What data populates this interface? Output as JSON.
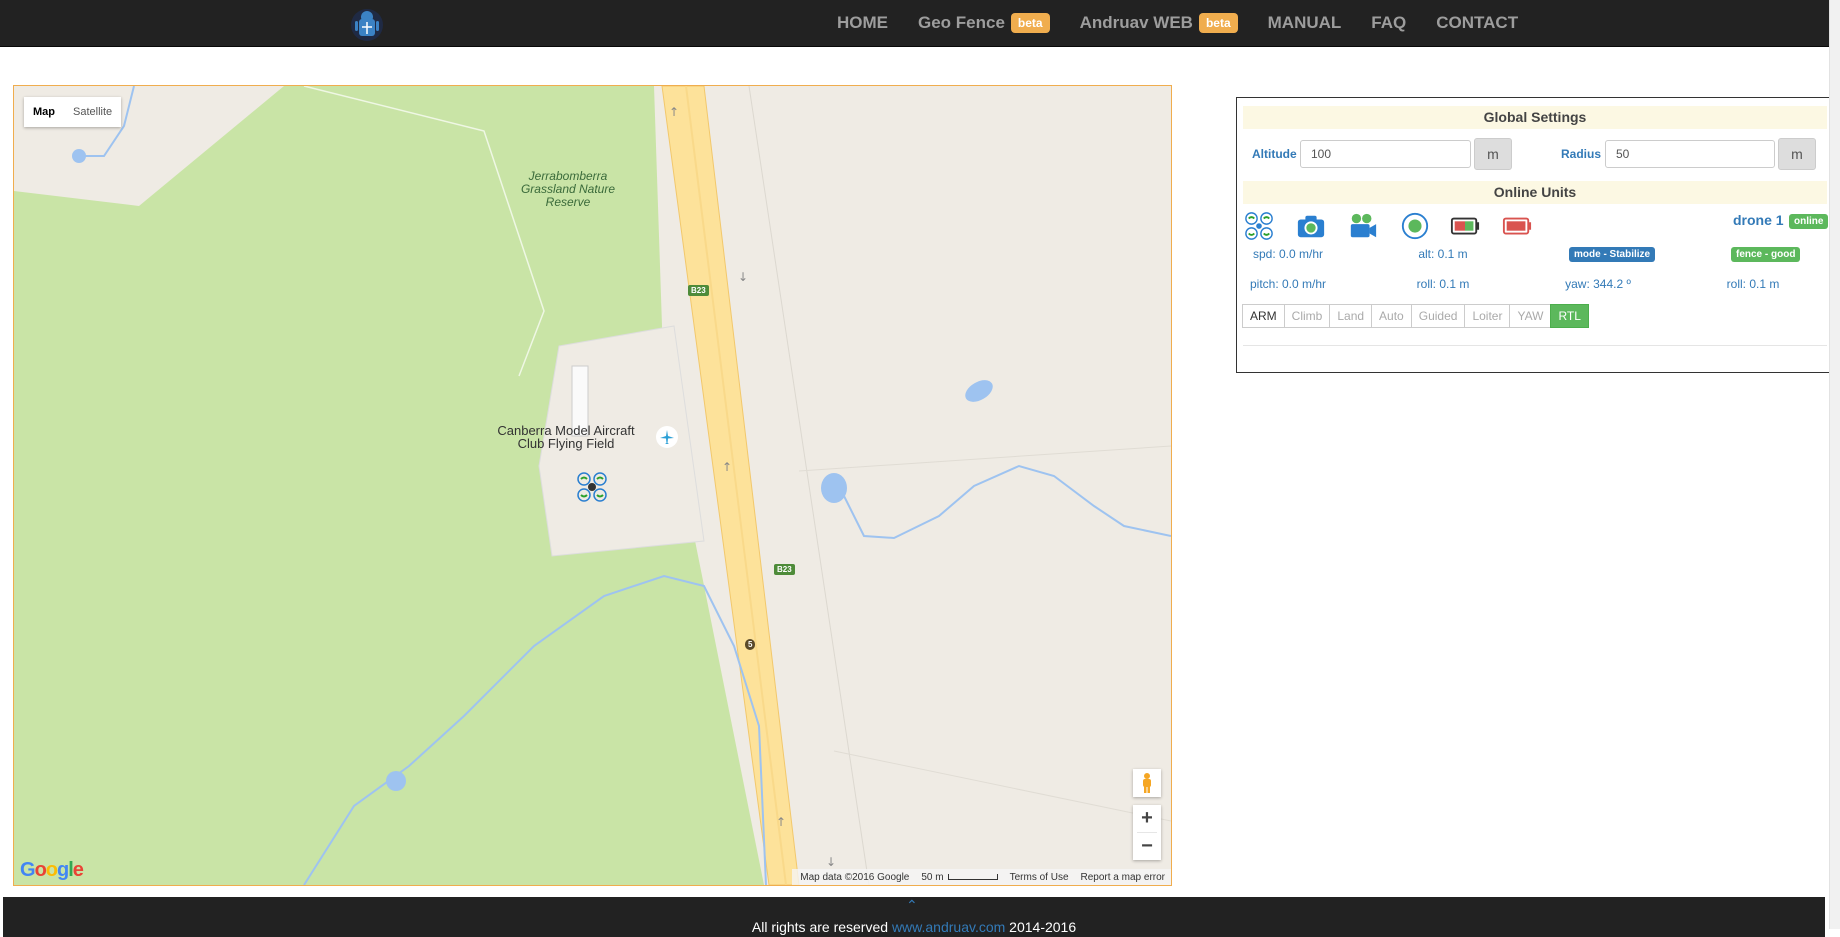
{
  "nav": {
    "items": [
      {
        "label": "HOME"
      },
      {
        "label": "Geo Fence",
        "badge": "beta"
      },
      {
        "label": "Andruav WEB",
        "badge": "beta"
      },
      {
        "label": "MANUAL"
      },
      {
        "label": "FAQ"
      },
      {
        "label": "CONTACT"
      }
    ]
  },
  "map": {
    "type_controls": {
      "map": "Map",
      "satellite": "Satellite"
    },
    "labels": {
      "reserve": "Jerrabomberra Grassland Nature Reserve",
      "field_line1": "Canberra Model Aircraft",
      "field_line2": "Club Flying Field",
      "road_shield": "B23",
      "route_marker": "5"
    },
    "zoom": {
      "in": "+",
      "out": "−"
    },
    "attribution": {
      "data": "Map data ©2016 Google",
      "scale": "50 m",
      "terms": "Terms of Use",
      "report": "Report a map error"
    },
    "logo": "Google"
  },
  "panel": {
    "global_settings": "Global Settings",
    "altitude_label": "Altitude",
    "altitude_value": "100",
    "altitude_unit": "m",
    "radius_label": "Radius",
    "radius_value": "50",
    "radius_unit": "m",
    "online_units": "Online Units",
    "unit": {
      "name": "drone 1",
      "status": "online",
      "icons": [
        "drone-icon",
        "camera-icon",
        "video-camera-icon",
        "record-icon",
        "battery-good-icon",
        "battery-low-icon"
      ],
      "spd": "spd: 0.0 m/hr",
      "alt": "alt: 0.1 m",
      "mode": "mode - Stabilize",
      "fence": "fence - good",
      "pitch": "pitch: 0.0 m/hr",
      "roll": "roll: 0.1 m",
      "yaw": "yaw: 344.2 º",
      "roll2": "roll: 0.1 m",
      "buttons": [
        "ARM",
        "Climb",
        "Land",
        "Auto",
        "Guided",
        "Loiter",
        "YAW",
        "RTL"
      ]
    }
  },
  "footer": {
    "prefix": "All rights are reserved ",
    "link": "www.andruav.com",
    "suffix": " 2014-2016"
  },
  "colors": {
    "navbar": "#222222",
    "accent": "#337ab7",
    "beta": "#f0ad4e",
    "success": "#5cb85c",
    "map_green": "#c9e4a6"
  }
}
